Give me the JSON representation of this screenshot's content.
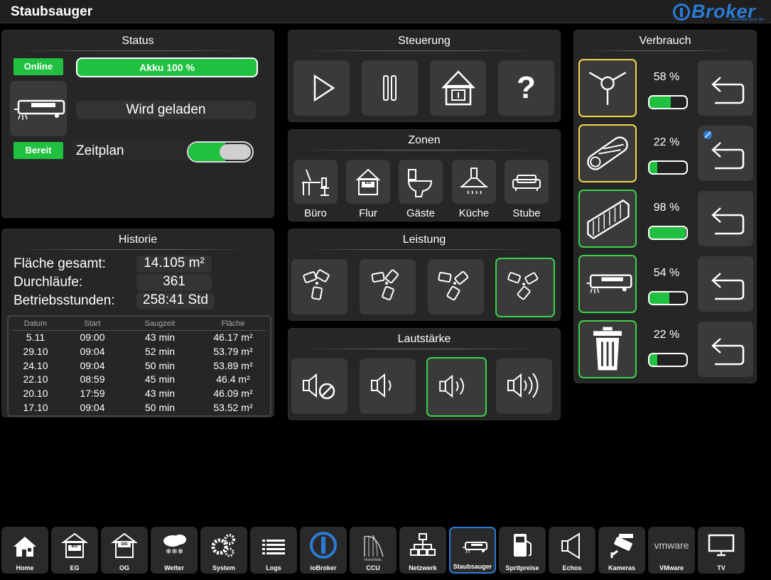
{
  "header": {
    "title": "Staubsauger",
    "logo_brand": "Broker",
    "logo_tag": "automate your life"
  },
  "status": {
    "title": "Status",
    "online_label": "Online",
    "akku_label": "Akku 100 %",
    "state_text": "Wird geladen",
    "bereit_label": "Bereit",
    "zeitplan_label": "Zeitplan",
    "zeitplan_on": true
  },
  "steuerung": {
    "title": "Steuerung",
    "buttons": [
      {
        "icon": "play-icon"
      },
      {
        "icon": "pause-icon"
      },
      {
        "icon": "home-base-icon"
      },
      {
        "icon": "question-icon",
        "label": "?"
      }
    ]
  },
  "zonen": {
    "title": "Zonen",
    "items": [
      {
        "label": "Büro",
        "icon": "desk-icon"
      },
      {
        "label": "Flur",
        "icon": "house-eg-icon",
        "icon_text": "EG"
      },
      {
        "label": "Gäste",
        "icon": "toilet-icon"
      },
      {
        "label": "Küche",
        "icon": "hood-icon"
      },
      {
        "label": "Stube",
        "icon": "sofa-icon"
      }
    ]
  },
  "leistung": {
    "title": "Leistung",
    "active_index": 3
  },
  "lautstaerke": {
    "title": "Lautstärke",
    "active_index": 2
  },
  "verbrauch": {
    "title": "Verbrauch",
    "items": [
      {
        "percent_text": "58 %",
        "level": 0.58,
        "icon": "side-brush-icon"
      },
      {
        "percent_text": "22 %",
        "level": 0.22,
        "icon": "main-brush-icon"
      },
      {
        "percent_text": "98 %",
        "level": 0.98,
        "icon": "filter-icon"
      },
      {
        "percent_text": "54 %",
        "level": 0.54,
        "icon": "sensor-icon"
      },
      {
        "percent_text": "22 %",
        "level": 0.22,
        "icon": "trash-icon"
      }
    ]
  },
  "historie": {
    "title": "Historie",
    "flaeche_label": "Fläche gesamt:",
    "flaeche_value": "14.105 m²",
    "durchlaeufe_label": "Durchläufe:",
    "durchlaeufe_value": "361",
    "stunden_label": "Betriebsstunden:",
    "stunden_value": "258:41 Std",
    "columns": [
      "Datum",
      "Start",
      "Saugzeit",
      "Fläche"
    ],
    "rows": [
      [
        "5.11",
        "09:00",
        "43 min",
        "46.17 m²"
      ],
      [
        "29.10",
        "09:04",
        "52 min",
        "53.79 m²"
      ],
      [
        "24.10",
        "09:04",
        "50 min",
        "53.89 m²"
      ],
      [
        "22.10",
        "08:59",
        "45 min",
        "46.4 m²"
      ],
      [
        "20.10",
        "17:59",
        "43 min",
        "46.09 m²"
      ],
      [
        "17.10",
        "09:04",
        "50 min",
        "53.52 m²"
      ]
    ]
  },
  "nav": [
    {
      "label": "Home",
      "icon": "home-icon"
    },
    {
      "label": "EG",
      "icon": "eg-icon",
      "icon_text": "EG"
    },
    {
      "label": "OG",
      "icon": "og-icon",
      "icon_text": "OG"
    },
    {
      "label": "Wetter",
      "icon": "weather-icon"
    },
    {
      "label": "System",
      "icon": "gears-icon"
    },
    {
      "label": "Logs",
      "icon": "logs-icon"
    },
    {
      "label": "ioBroker",
      "icon": "iobroker-icon"
    },
    {
      "label": "CCU",
      "icon": "ccu-icon",
      "icon_text": "HomeMatic"
    },
    {
      "label": "Netzwerk",
      "icon": "network-icon"
    },
    {
      "label": "Staubsauger",
      "icon": "vacuum-icon",
      "active": true
    },
    {
      "label": "Spritpreise",
      "icon": "fuel-icon"
    },
    {
      "label": "Echos",
      "icon": "speaker-icon"
    },
    {
      "label": "Kameras",
      "icon": "camera-icon"
    },
    {
      "label": "VMware",
      "icon": "vmware-icon",
      "icon_text": "vmware"
    },
    {
      "label": "TV",
      "icon": "tv-icon"
    }
  ],
  "colors": {
    "accent_green": "#20c040",
    "accent_blue": "#2b7bd6",
    "accent_yellow": "#f0d84a"
  }
}
